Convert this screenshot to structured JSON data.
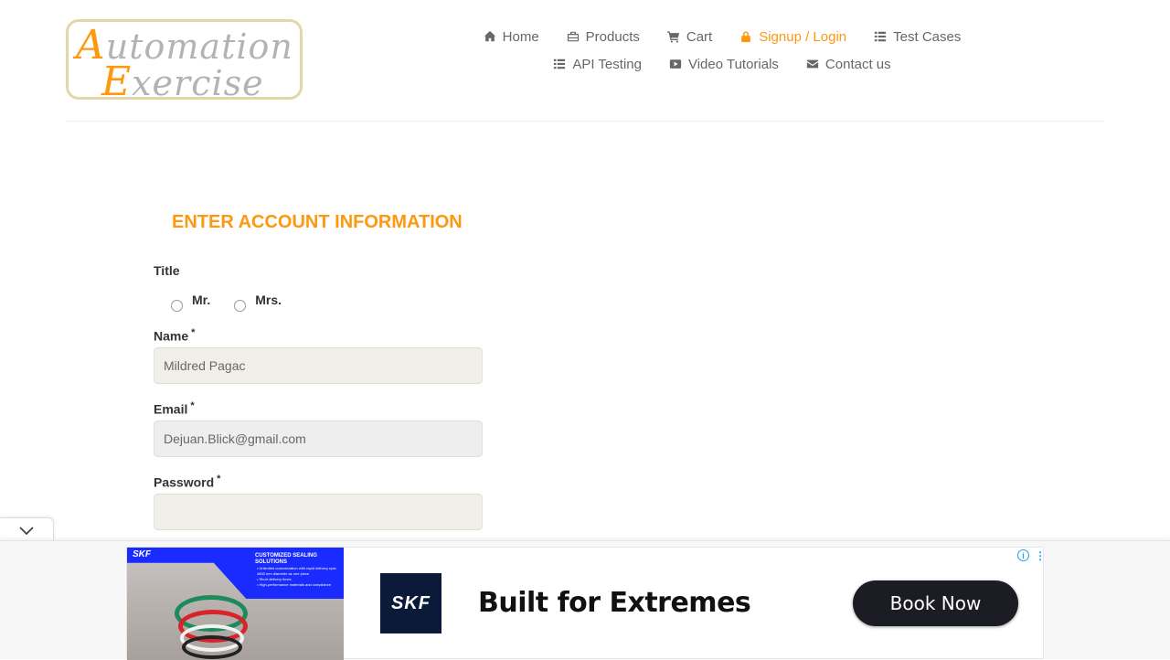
{
  "logo": {
    "line1_cap": "A",
    "line1_rest": "utomation",
    "line2_cap": "E",
    "line2_rest": "xercise"
  },
  "nav": [
    {
      "label": "Home",
      "icon": "home-icon"
    },
    {
      "label": "Products",
      "icon": "briefcase-icon"
    },
    {
      "label": "Cart",
      "icon": "cart-icon"
    },
    {
      "label": "Signup / Login",
      "icon": "lock-icon",
      "active": true
    },
    {
      "label": "Test Cases",
      "icon": "list-icon"
    },
    {
      "label": "API Testing",
      "icon": "list-icon"
    },
    {
      "label": "Video Tutorials",
      "icon": "youtube-play-icon"
    },
    {
      "label": "Contact us",
      "icon": "envelope-icon"
    }
  ],
  "form": {
    "title": "ENTER ACCOUNT INFORMATION",
    "title_label": "Title",
    "title_options": [
      "Mr.",
      "Mrs."
    ],
    "name_label": "Name",
    "name_value": "Mildred Pagac",
    "email_label": "Email",
    "email_value": "Dejuan.Blick@gmail.com",
    "password_label": "Password",
    "password_value": "",
    "required_mark": "*"
  },
  "ad": {
    "brand": "SKF",
    "image_headline": "CUSTOMIZED SEALING SOLUTIONS",
    "image_bullets": [
      "Unlimited customization with rapid delivery upto 4600 mm diameter as one piece",
      "Short delivery times",
      "High-performance materials and compliance"
    ],
    "headline": "Built for Extremes",
    "cta": "Book Now"
  },
  "colors": {
    "accent": "#fe980f",
    "field_bg": "#F0F0E9",
    "text": "#696763"
  }
}
